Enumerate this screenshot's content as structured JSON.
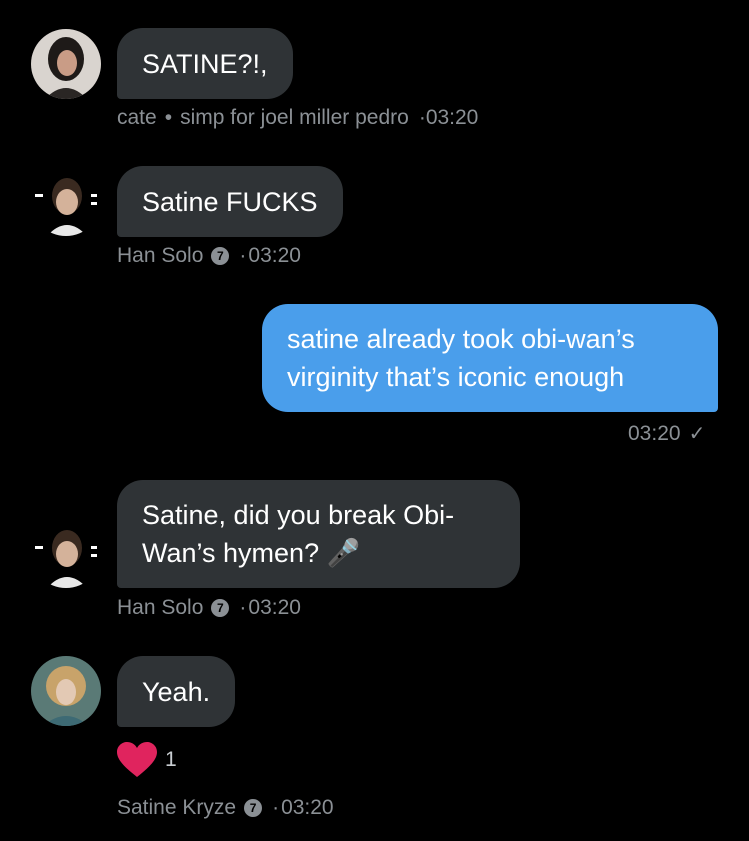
{
  "messages": [
    {
      "text": "SATINE?!,",
      "sender": "cate",
      "bio": "simp for joel miller pedro",
      "time": "03:20"
    },
    {
      "text": "Satine FUCKS",
      "sender": "Han Solo",
      "time": "03:20"
    },
    {
      "text_line1": "satine already took obi-wan’s",
      "text_line2": "virginity that’s iconic enough",
      "time": "03:20"
    },
    {
      "text_line1": "Satine, did you break Obi-",
      "text_line2": "Wan’s hymen? 🎤",
      "sender": "Han Solo",
      "time": "03:20"
    },
    {
      "text": "Yeah.",
      "sender": "Satine Kryze",
      "time": "03:20",
      "reaction_count": "1"
    }
  ],
  "separator": "•",
  "time_prefix": "·",
  "badge_glyph": "7",
  "check_glyph": "✓",
  "icons": {
    "verified": "verified-badge-icon",
    "reaction": "heart-icon",
    "read": "check-icon"
  },
  "colors": {
    "background": "#000000",
    "received_bubble": "#2f3336",
    "sent_bubble": "#4a9eeb",
    "meta": "#8b9095",
    "heart": "#e0245e"
  }
}
